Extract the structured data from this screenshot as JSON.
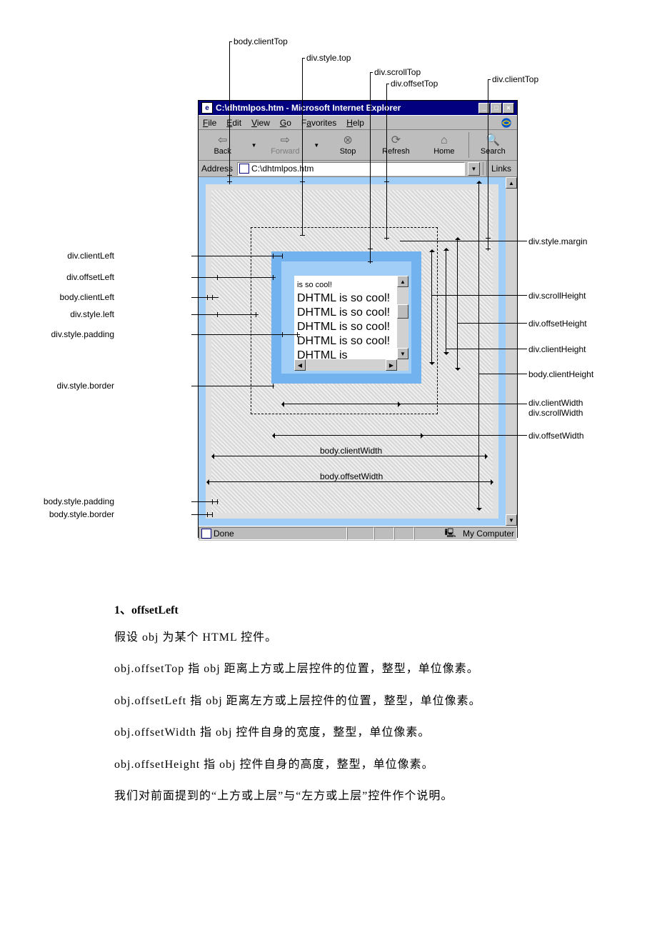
{
  "annotations": {
    "top": {
      "bodyClientTop": "body.clientTop",
      "divStyleTop": "div.style.top",
      "divScrollTop": "div.scrollTop",
      "divOffsetTop": "div.offsetTop",
      "divClientTop": "div.clientTop"
    },
    "left": {
      "divClientLeft": "div.clientLeft",
      "divOffsetLeft": "div.offsetLeft",
      "bodyClientLeft": "body.clientLeft",
      "divStyleLeft": "div.style.left",
      "divStylePadding": "div.style.padding",
      "divStyleBorder": "div.style.border",
      "bodyStylePadding": "body.style.padding",
      "bodyStyleBorder": "body.style.border"
    },
    "right": {
      "divStyleMargin": "div.style.margin",
      "divScrollHeight": "div.scrollHeight",
      "divOffsetHeight": "div.offsetHeight",
      "divClientHeight": "div.clientHeight",
      "bodyClientHeight": "body.clientHeight",
      "divClientWidth": "div.clientWidth",
      "divScrollWidth": "div.scrollWidth",
      "divOffsetWidth": "div.offsetWidth"
    },
    "bottom": {
      "bodyClientWidth": "body.clientWidth",
      "bodyOffsetWidth": "body.offsetWidth"
    }
  },
  "ie": {
    "title": "C:\\dhtmlpos.htm - Microsoft Internet Explorer",
    "menu": {
      "file": "File",
      "edit": "Edit",
      "view": "View",
      "go": "Go",
      "favorites": "Favorites",
      "help": "Help"
    },
    "toolbar": {
      "back": "Back",
      "forward": "Forward",
      "stop": "Stop",
      "refresh": "Refresh",
      "home": "Home",
      "search": "Search"
    },
    "addressLabel": "Address",
    "addressValue": "C:\\dhtmlpos.htm",
    "linksLabel": "Links",
    "innerFirstLine": "is so cool!",
    "innerText": "DHTML is so cool! DHTML is so cool! DHTML is so cool! DHTML is so cool! DHTML is",
    "statusDone": "Done",
    "statusZone": "My Computer"
  },
  "article": {
    "heading": "1、offsetLeft",
    "p1": "假设 obj 为某个 HTML 控件。",
    "p2": "obj.offsetTop 指 obj 距离上方或上层控件的位置，整型，单位像素。",
    "p3": "obj.offsetLeft 指 obj 距离左方或上层控件的位置，整型，单位像素。",
    "p4": "obj.offsetWidth 指 obj 控件自身的宽度，整型，单位像素。",
    "p5": "obj.offsetHeight 指 obj 控件自身的高度，整型，单位像素。",
    "p6": "我们对前面提到的“上方或上层”与“左方或上层”控件作个说明。"
  }
}
